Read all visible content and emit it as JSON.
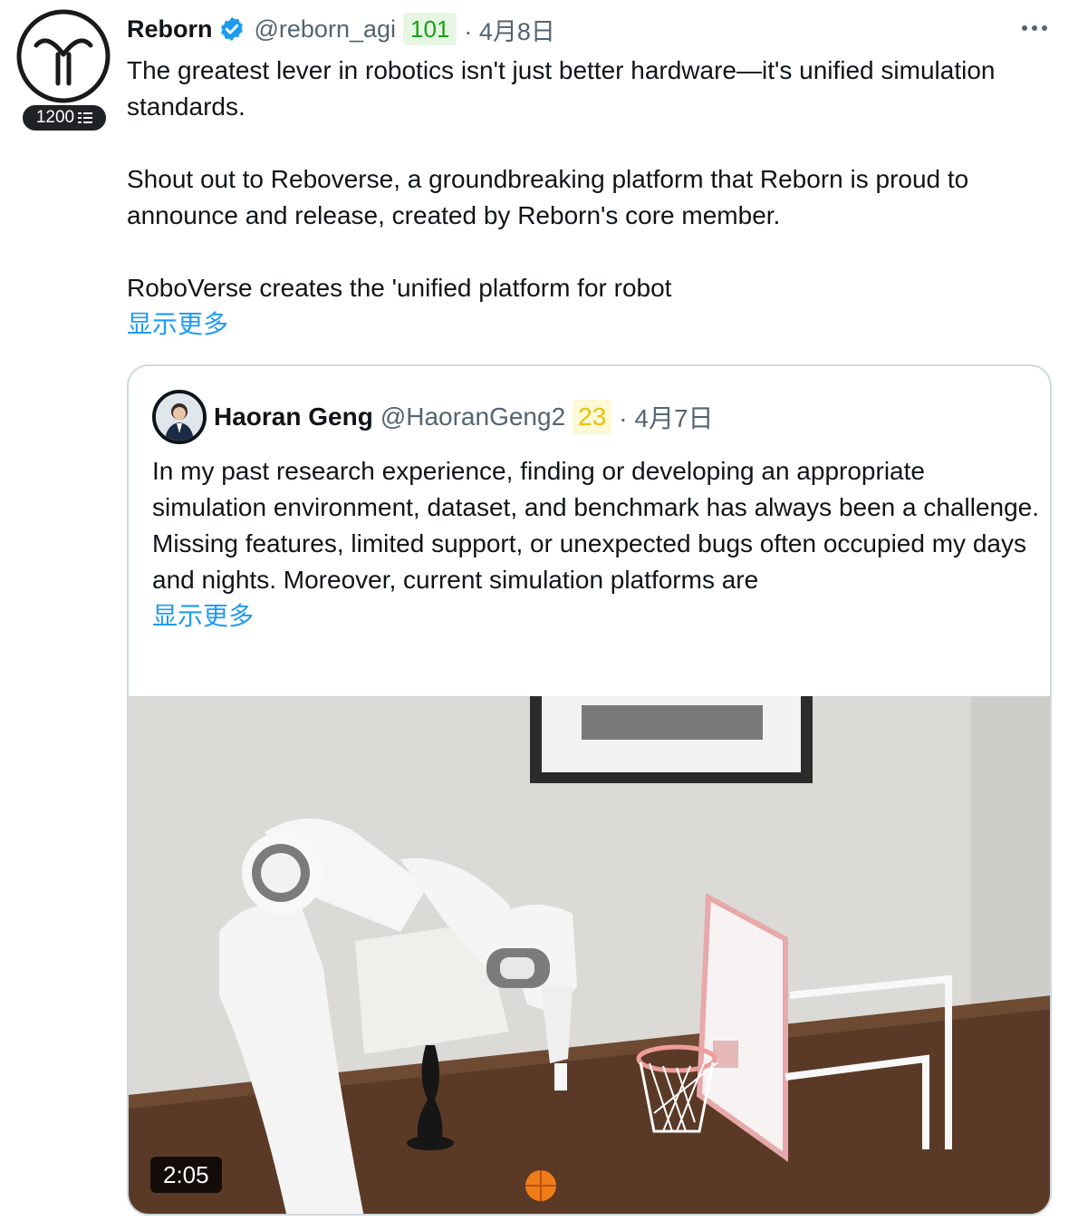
{
  "author": {
    "name": "Reborn",
    "handle": "@reborn_agi",
    "score": "101",
    "date": "· 4月8日",
    "follower_badge": "1200"
  },
  "tweet": {
    "para1": "The greatest lever in robotics isn't just better hardware—it's unified simulation standards.",
    "para2": "Shout out to Reboverse, a groundbreaking platform that Reborn is proud to announce and release, created by Reborn's core member.",
    "para3": "RoboVerse creates the 'unified platform for robot",
    "show_more": "显示更多"
  },
  "quote": {
    "name": "Haoran Geng",
    "handle": "@HaoranGeng2",
    "score": "23",
    "date": "· 4月7日",
    "text": "In my past research experience, finding or developing an appropriate simulation environment, dataset, and benchmark has always been a challenge. Missing features, limited support, or unexpected bugs often occupied my days and nights. Moreover, current simulation platforms are",
    "show_more": "显示更多",
    "video_duration": "2:05"
  },
  "colors": {
    "link": "#1d9bf0",
    "verified": "#1d9bf0",
    "score_green": "#18a014",
    "score_yellow": "#e5c20a",
    "secondary_text": "#536471"
  },
  "icons": {
    "avatar": "reborn-logo-icon",
    "verified": "verified-badge-icon",
    "more": "more-dots-icon",
    "follower": "stack-icon"
  }
}
